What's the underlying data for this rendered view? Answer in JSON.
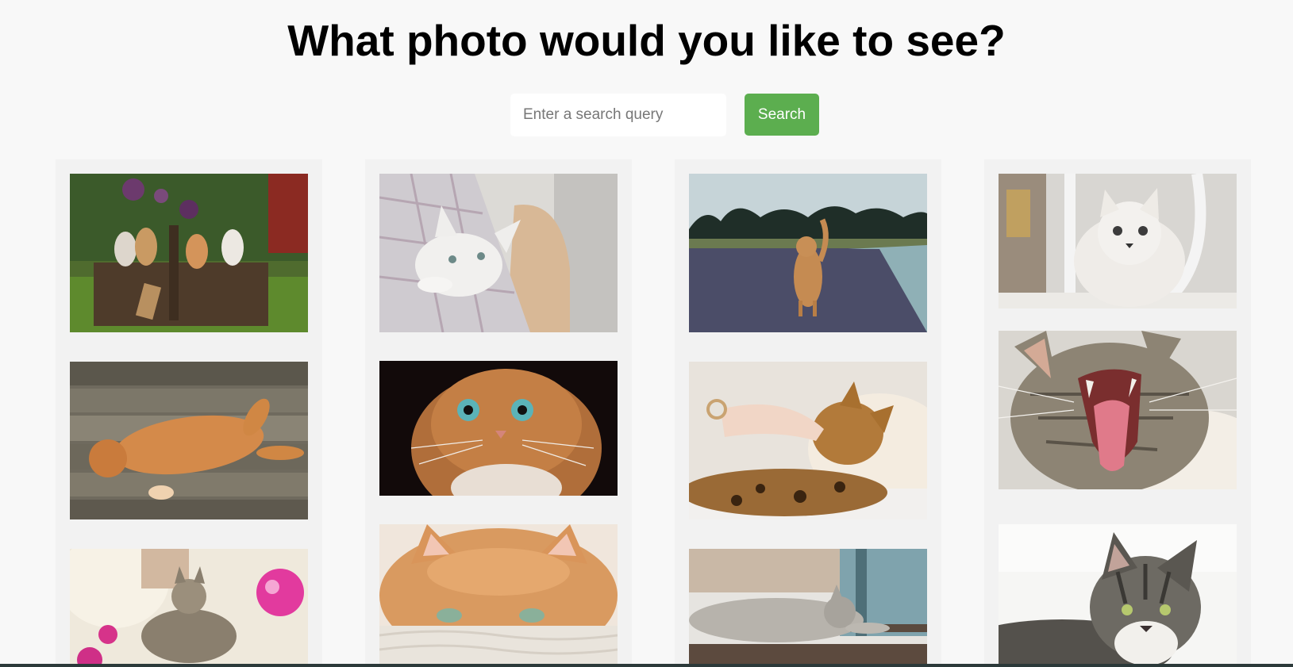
{
  "page": {
    "title": "What photo would you like to see?"
  },
  "search": {
    "placeholder": "Enter a search query",
    "button_label": "Search",
    "button_color": "#5cae4f"
  },
  "photos": [
    {
      "column": 1,
      "subject": "four kittens in a wicker basket on grass"
    },
    {
      "column": 1,
      "subject": "orange cat lying on its back on wooden deck"
    },
    {
      "column": 1,
      "subject": "tabby kitten playing with pink ball"
    },
    {
      "column": 2,
      "subject": "white kitten peeking out of a plaid blanket"
    },
    {
      "column": 2,
      "subject": "orange scottish fold cat with blue eyes"
    },
    {
      "column": 2,
      "subject": "orange cat peeking over a knitted blanket"
    },
    {
      "column": 3,
      "subject": "ginger cat standing on a road"
    },
    {
      "column": 3,
      "subject": "bengal cat being petted by a hand"
    },
    {
      "column": 3,
      "subject": "grey cat lying by a window"
    },
    {
      "column": 4,
      "subject": "fluffy white kitten under a chair"
    },
    {
      "column": 4,
      "subject": "tabby cat yawning"
    },
    {
      "column": 4,
      "subject": "grey tabby cat resting"
    }
  ]
}
